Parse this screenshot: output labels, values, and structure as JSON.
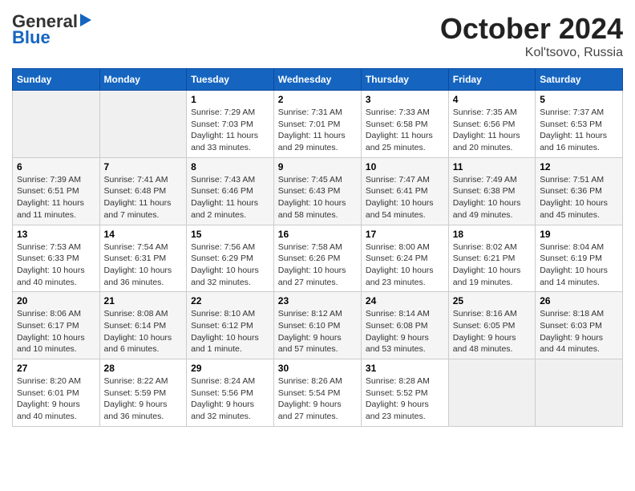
{
  "header": {
    "logo_line1": "General",
    "logo_line2": "Blue",
    "month": "October 2024",
    "location": "Kol'tsovo, Russia"
  },
  "days_of_week": [
    "Sunday",
    "Monday",
    "Tuesday",
    "Wednesday",
    "Thursday",
    "Friday",
    "Saturday"
  ],
  "weeks": [
    [
      {
        "num": "",
        "info": ""
      },
      {
        "num": "",
        "info": ""
      },
      {
        "num": "1",
        "info": "Sunrise: 7:29 AM\nSunset: 7:03 PM\nDaylight: 11 hours and 33 minutes."
      },
      {
        "num": "2",
        "info": "Sunrise: 7:31 AM\nSunset: 7:01 PM\nDaylight: 11 hours and 29 minutes."
      },
      {
        "num": "3",
        "info": "Sunrise: 7:33 AM\nSunset: 6:58 PM\nDaylight: 11 hours and 25 minutes."
      },
      {
        "num": "4",
        "info": "Sunrise: 7:35 AM\nSunset: 6:56 PM\nDaylight: 11 hours and 20 minutes."
      },
      {
        "num": "5",
        "info": "Sunrise: 7:37 AM\nSunset: 6:53 PM\nDaylight: 11 hours and 16 minutes."
      }
    ],
    [
      {
        "num": "6",
        "info": "Sunrise: 7:39 AM\nSunset: 6:51 PM\nDaylight: 11 hours and 11 minutes."
      },
      {
        "num": "7",
        "info": "Sunrise: 7:41 AM\nSunset: 6:48 PM\nDaylight: 11 hours and 7 minutes."
      },
      {
        "num": "8",
        "info": "Sunrise: 7:43 AM\nSunset: 6:46 PM\nDaylight: 11 hours and 2 minutes."
      },
      {
        "num": "9",
        "info": "Sunrise: 7:45 AM\nSunset: 6:43 PM\nDaylight: 10 hours and 58 minutes."
      },
      {
        "num": "10",
        "info": "Sunrise: 7:47 AM\nSunset: 6:41 PM\nDaylight: 10 hours and 54 minutes."
      },
      {
        "num": "11",
        "info": "Sunrise: 7:49 AM\nSunset: 6:38 PM\nDaylight: 10 hours and 49 minutes."
      },
      {
        "num": "12",
        "info": "Sunrise: 7:51 AM\nSunset: 6:36 PM\nDaylight: 10 hours and 45 minutes."
      }
    ],
    [
      {
        "num": "13",
        "info": "Sunrise: 7:53 AM\nSunset: 6:33 PM\nDaylight: 10 hours and 40 minutes."
      },
      {
        "num": "14",
        "info": "Sunrise: 7:54 AM\nSunset: 6:31 PM\nDaylight: 10 hours and 36 minutes."
      },
      {
        "num": "15",
        "info": "Sunrise: 7:56 AM\nSunset: 6:29 PM\nDaylight: 10 hours and 32 minutes."
      },
      {
        "num": "16",
        "info": "Sunrise: 7:58 AM\nSunset: 6:26 PM\nDaylight: 10 hours and 27 minutes."
      },
      {
        "num": "17",
        "info": "Sunrise: 8:00 AM\nSunset: 6:24 PM\nDaylight: 10 hours and 23 minutes."
      },
      {
        "num": "18",
        "info": "Sunrise: 8:02 AM\nSunset: 6:21 PM\nDaylight: 10 hours and 19 minutes."
      },
      {
        "num": "19",
        "info": "Sunrise: 8:04 AM\nSunset: 6:19 PM\nDaylight: 10 hours and 14 minutes."
      }
    ],
    [
      {
        "num": "20",
        "info": "Sunrise: 8:06 AM\nSunset: 6:17 PM\nDaylight: 10 hours and 10 minutes."
      },
      {
        "num": "21",
        "info": "Sunrise: 8:08 AM\nSunset: 6:14 PM\nDaylight: 10 hours and 6 minutes."
      },
      {
        "num": "22",
        "info": "Sunrise: 8:10 AM\nSunset: 6:12 PM\nDaylight: 10 hours and 1 minute."
      },
      {
        "num": "23",
        "info": "Sunrise: 8:12 AM\nSunset: 6:10 PM\nDaylight: 9 hours and 57 minutes."
      },
      {
        "num": "24",
        "info": "Sunrise: 8:14 AM\nSunset: 6:08 PM\nDaylight: 9 hours and 53 minutes."
      },
      {
        "num": "25",
        "info": "Sunrise: 8:16 AM\nSunset: 6:05 PM\nDaylight: 9 hours and 48 minutes."
      },
      {
        "num": "26",
        "info": "Sunrise: 8:18 AM\nSunset: 6:03 PM\nDaylight: 9 hours and 44 minutes."
      }
    ],
    [
      {
        "num": "27",
        "info": "Sunrise: 8:20 AM\nSunset: 6:01 PM\nDaylight: 9 hours and 40 minutes."
      },
      {
        "num": "28",
        "info": "Sunrise: 8:22 AM\nSunset: 5:59 PM\nDaylight: 9 hours and 36 minutes."
      },
      {
        "num": "29",
        "info": "Sunrise: 8:24 AM\nSunset: 5:56 PM\nDaylight: 9 hours and 32 minutes."
      },
      {
        "num": "30",
        "info": "Sunrise: 8:26 AM\nSunset: 5:54 PM\nDaylight: 9 hours and 27 minutes."
      },
      {
        "num": "31",
        "info": "Sunrise: 8:28 AM\nSunset: 5:52 PM\nDaylight: 9 hours and 23 minutes."
      },
      {
        "num": "",
        "info": ""
      },
      {
        "num": "",
        "info": ""
      }
    ]
  ]
}
